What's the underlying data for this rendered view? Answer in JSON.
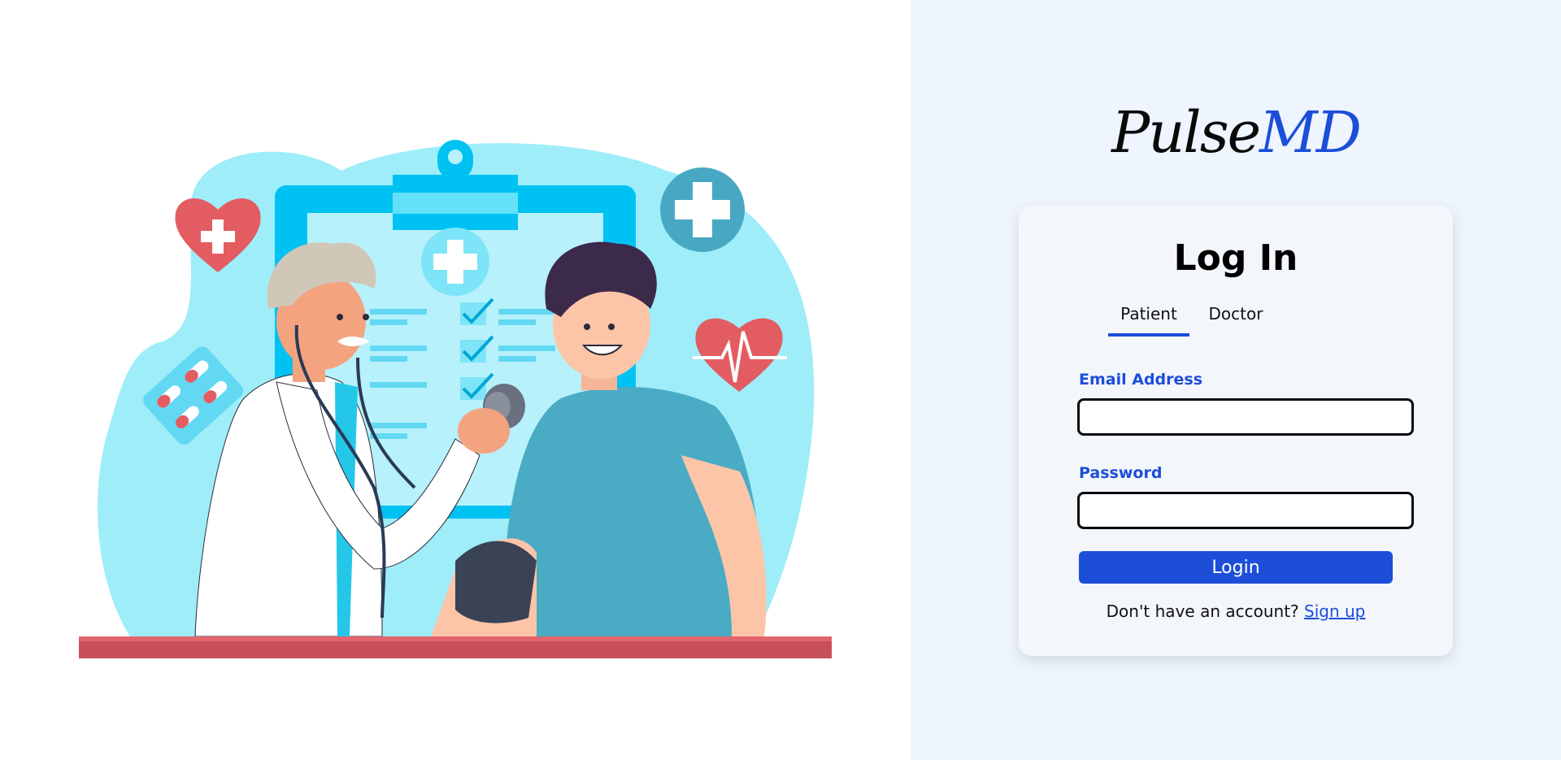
{
  "brand": {
    "name_part_1": "Pulse",
    "name_part_2": "MD",
    "accent_color": "#1d4ed8"
  },
  "login_card": {
    "title": "Log In",
    "tabs": [
      {
        "label": "Patient",
        "active": true
      },
      {
        "label": "Doctor",
        "active": false
      }
    ],
    "email": {
      "label": "Email Address",
      "value": "",
      "placeholder": ""
    },
    "password": {
      "label": "Password",
      "value": "",
      "placeholder": ""
    },
    "login_button": "Login",
    "signup_prompt": "Don't have an account?",
    "signup_link": "Sign up"
  },
  "illustration": {
    "subject": "doctor-measuring-patient-blood-pressure",
    "icons": [
      "heart-plus-icon",
      "medical-cross-icon",
      "pills-icon",
      "heartbeat-icon",
      "clipboard-icon",
      "stethoscope-icon"
    ]
  }
}
